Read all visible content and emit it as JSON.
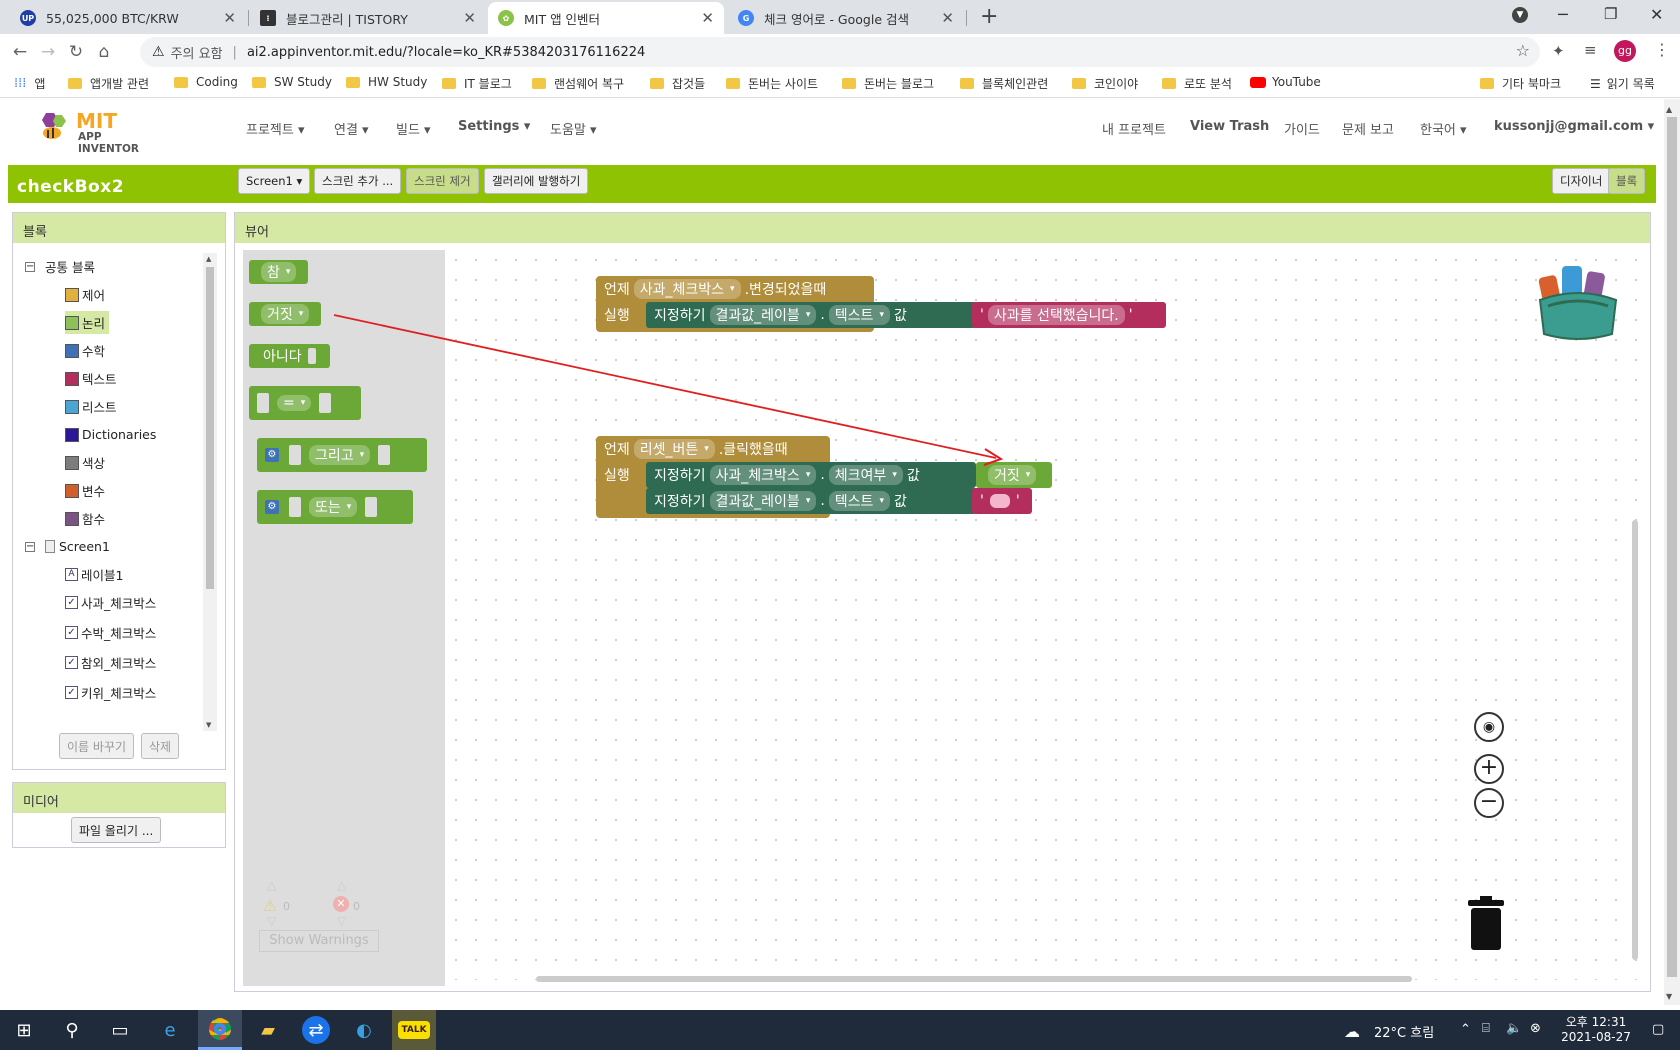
{
  "browser": {
    "tabs": [
      {
        "title": "55,025,000 BTC/KRW",
        "icon": "upbit-icon"
      },
      {
        "title": "블로그관리 | TISTORY",
        "icon": "tistory-icon"
      },
      {
        "title": "MIT 앱 인벤터",
        "icon": "appinventor-icon"
      },
      {
        "title": "체크 영어로 - Google 검색",
        "icon": "google-icon"
      }
    ],
    "security_label": "주의 요함",
    "url": "ai2.appinventor.mit.edu/?locale=ko_KR#5384203176116224",
    "profile": "gg",
    "bookmarks": [
      "앱",
      "앱개발 관련",
      "Coding",
      "SW Study",
      "HW Study",
      "IT 블로그",
      "랜섬웨어 복구",
      "잡것들",
      "돈버는 사이트",
      "돈버는 블로그",
      "블록체인관련",
      "코인이야",
      "로또 분석",
      "YouTube",
      "기타 북마크",
      "읽기 목록"
    ]
  },
  "app": {
    "logo_top": "MIT",
    "logo_bottom": "APP INVENTOR",
    "menu": [
      "프로젝트",
      "연결",
      "빌드",
      "Settings",
      "도움말"
    ],
    "right_menu": [
      "내 프로젝트",
      "View Trash",
      "가이드",
      "문제 보고",
      "한국어",
      "kussonjj@gmail.com"
    ],
    "project_name": "checkBox2",
    "screen_select": "Screen1",
    "add_screen": "스크린 추가 ...",
    "remove_screen": "스크린 제거",
    "publish": "갤러리에 발행하기",
    "designer": "디자이너",
    "blocks_btn": "블록"
  },
  "blocks_panel": {
    "title": "블록",
    "builtin": "공통 블록",
    "categories": [
      {
        "label": "제어",
        "color": "#e0b040"
      },
      {
        "label": "논리",
        "color": "#8cc059"
      },
      {
        "label": "수학",
        "color": "#3f71b5"
      },
      {
        "label": "텍스트",
        "color": "#b32d5d"
      },
      {
        "label": "리스트",
        "color": "#49a6d4"
      },
      {
        "label": "Dictionaries",
        "color": "#2d1799"
      },
      {
        "label": "색상",
        "color": "#7d7d7d"
      },
      {
        "label": "변수",
        "color": "#d05f2d"
      },
      {
        "label": "함수",
        "color": "#7c5385"
      }
    ],
    "screen": "Screen1",
    "components": [
      "레이블1",
      "사과_체크박스",
      "수박_체크박스",
      "참외_체크박스",
      "키위_체크박스"
    ],
    "rename": "이름 바꾸기",
    "delete": "삭제"
  },
  "media": {
    "title": "미디어",
    "upload": "파일 올리기 ..."
  },
  "viewer": {
    "title": "뷰어",
    "flyout": {
      "true": "참",
      "false": "거짓",
      "not": "아니다",
      "eq": "=",
      "and": "그리고",
      "or": "또는"
    },
    "warnings_count": "0",
    "errors_count": "0",
    "show_warnings": "Show Warnings",
    "event1": {
      "when": "언제",
      "component": "사과_체크박스",
      "event": ".변경되었을때",
      "do": "실행",
      "set": "지정하기",
      "target": "결과값_레이블",
      "prop": "텍스트",
      "to": "값",
      "value": "사과를 선택했습니다."
    },
    "event2": {
      "when": "언제",
      "component": "리셋_버튼",
      "event": ".클릭했을때",
      "do": "실행",
      "set": "지정하기",
      "target1": "사과_체크박스",
      "prop1": "체크여부",
      "value1": "거짓",
      "target2": "결과값_레이블",
      "prop2": "텍스트",
      "to": "값"
    }
  },
  "taskbar": {
    "weather": "22°C 흐림",
    "time": "오후 12:31",
    "date": "2021-08-27"
  }
}
